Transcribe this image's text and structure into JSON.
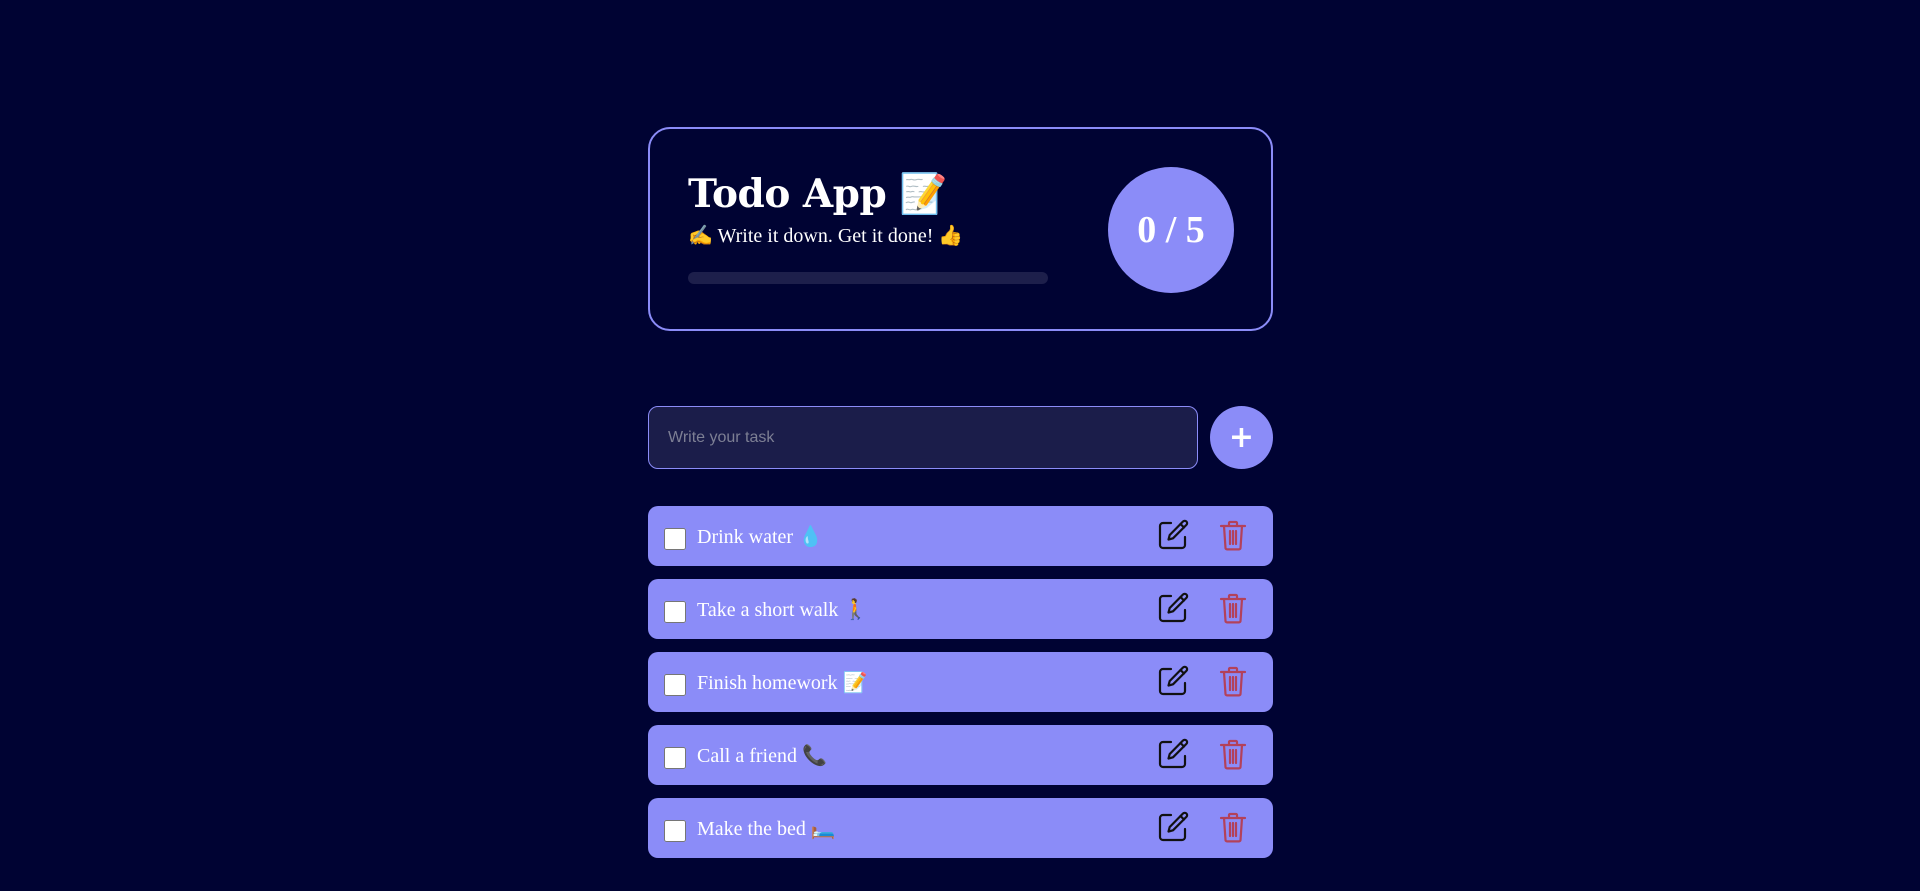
{
  "header": {
    "title": "Todo App 📝",
    "subtitle": "✍️ Write it down. Get it done! 👍",
    "progress": {
      "completed": 0,
      "total": 5,
      "fraction": 0
    },
    "count_label": "0 / 5"
  },
  "form": {
    "placeholder": "Write your task",
    "value": "",
    "add_label": "+"
  },
  "todos": [
    {
      "text": "Drink water 💧",
      "done": false
    },
    {
      "text": "Take a short walk 🚶",
      "done": false
    },
    {
      "text": "Finish homework 📝",
      "done": false
    },
    {
      "text": "Call a friend 📞",
      "done": false
    },
    {
      "text": "Make the bed 🛏️",
      "done": false
    }
  ],
  "icons": {
    "edit": "edit-icon",
    "delete": "trash-icon"
  },
  "colors": {
    "background": "#000333",
    "accent": "#8b8cf8",
    "input_bg": "#1b1d4a",
    "progress_track": "#1d1f4b",
    "trash_icon": "#b3415a",
    "edit_icon": "#111111"
  }
}
